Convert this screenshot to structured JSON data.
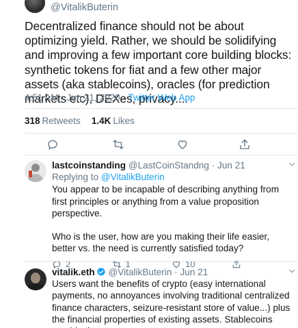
{
  "main_tweet": {
    "handle": "@VitalikButerin",
    "text": "Decentralized finance should not be about optimizing yield. Rather, we should be solidifying and improving a few important core building blocks: synthetic tokens for fiat and a few other major assets (aka stablecoins), oracles (for prediction markets etc), DEXes, privacy....",
    "time": "4:51 AM · Jun 21, 2020 · ",
    "source": "Twitter Web App",
    "retweets_count": "318",
    "retweets_label": "Retweets",
    "likes_count": "1.4K",
    "likes_label": "Likes"
  },
  "replies": [
    {
      "name": "lastcoinstanding",
      "handle": "@LastCoinStandng",
      "time": "· Jun 21",
      "replying_prefix": "Replying to ",
      "replying_to": "@VitalikButerin",
      "text_p1": "You appear to be incapable of describing anything from first principles or anything from a value proposition perspective.",
      "text_p2": "Who is the user, how are you making their life easier, better vs. the need is currently satisfied today?",
      "reply_count": "2",
      "retweet_count": "1",
      "like_count": "10"
    },
    {
      "name": "vitalik.eth",
      "handle": "@VitalikButerin",
      "time": "· Jun 21",
      "text_p1": "Users want the benefits of crypto (easy international payments, no annoyances involving traditional centralized finance characters, seizure-resistant store of value...) plus the financial properties of existing assets. Stablecoins provide that."
    }
  ],
  "colors": {
    "accent": "#1da1f2",
    "muted": "#657786",
    "text": "#14171a",
    "border": "#e1e8ed"
  },
  "icons": [
    "reply-icon",
    "retweet-icon",
    "like-icon",
    "share-icon",
    "chevron-down-icon",
    "verified-icon"
  ]
}
